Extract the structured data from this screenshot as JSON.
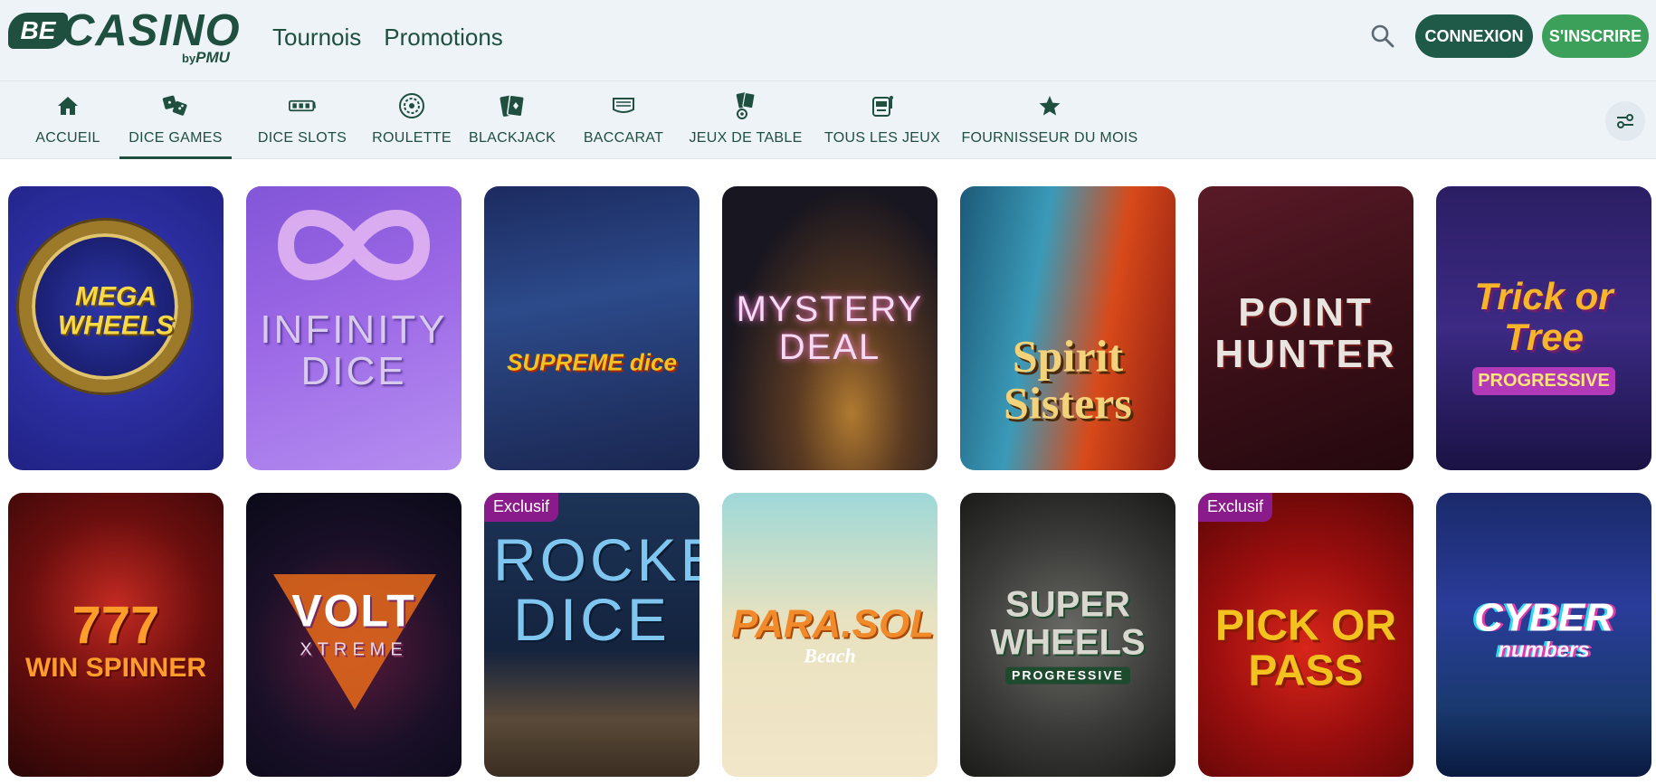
{
  "brand": {
    "be": "BE",
    "casino": "CASINO",
    "by": "by",
    "pmu": "PMU"
  },
  "topnav": [
    {
      "label": "Tournois"
    },
    {
      "label": "Promotions"
    }
  ],
  "header_buttons": {
    "login": "CONNEXION",
    "signup": "S'INSCRIRE"
  },
  "categories": [
    {
      "label": "ACCUEIL",
      "icon": "home-icon",
      "active": false
    },
    {
      "label": "DICE GAMES",
      "icon": "dice-icon",
      "active": true
    },
    {
      "label": "DICE SLOTS",
      "icon": "slot-reels-icon",
      "active": false
    },
    {
      "label": "ROULETTE",
      "icon": "roulette-wheel-icon",
      "active": false
    },
    {
      "label": "BLACKJACK",
      "icon": "cards-icon",
      "active": false
    },
    {
      "label": "BACCARAT",
      "icon": "baccarat-table-icon",
      "active": false
    },
    {
      "label": "JEUX DE TABLE",
      "icon": "table-cards-icon",
      "active": false
    },
    {
      "label": "TOUS LES JEUX",
      "icon": "slot-machine-icon",
      "active": false
    },
    {
      "label": "FOURNISSEUR DU MOIS",
      "icon": "star-icon",
      "active": false
    }
  ],
  "games": {
    "row1": [
      {
        "title": "MEGA WHEELS",
        "badge": ""
      },
      {
        "title": "INFINITY DICE",
        "badge": ""
      },
      {
        "title": "SUPREME dice",
        "badge": ""
      },
      {
        "title": "MYSTERY DEAL",
        "badge": ""
      },
      {
        "title": "Spirit Sisters",
        "badge": ""
      },
      {
        "title": "POINT HUNTER",
        "badge": ""
      },
      {
        "title": "Trick or Tree",
        "subtitle": "PROGRESSIVE",
        "badge": ""
      }
    ],
    "row2": [
      {
        "title": "777",
        "subtitle": "WIN SPINNER",
        "badge": ""
      },
      {
        "title": "VOLT",
        "subtitle": "XTREME",
        "badge": ""
      },
      {
        "title": "ROCKET DICE",
        "badge": "Exclusif"
      },
      {
        "title": "PARA.SOL",
        "subtitle": "Beach",
        "badge": ""
      },
      {
        "title": "SUPER WHEELS",
        "subtitle": "PROGRESSIVE",
        "badge": ""
      },
      {
        "title": "PICK OR PASS",
        "badge": "Exclusif"
      },
      {
        "title": "CYBER",
        "subtitle": "numbers",
        "badge": ""
      }
    ]
  },
  "colors": {
    "primary": "#1f4f3f",
    "signup": "#3ca05a",
    "exclusive_badge": "#8a1b8a",
    "bar_bg": "#eef3f8"
  }
}
